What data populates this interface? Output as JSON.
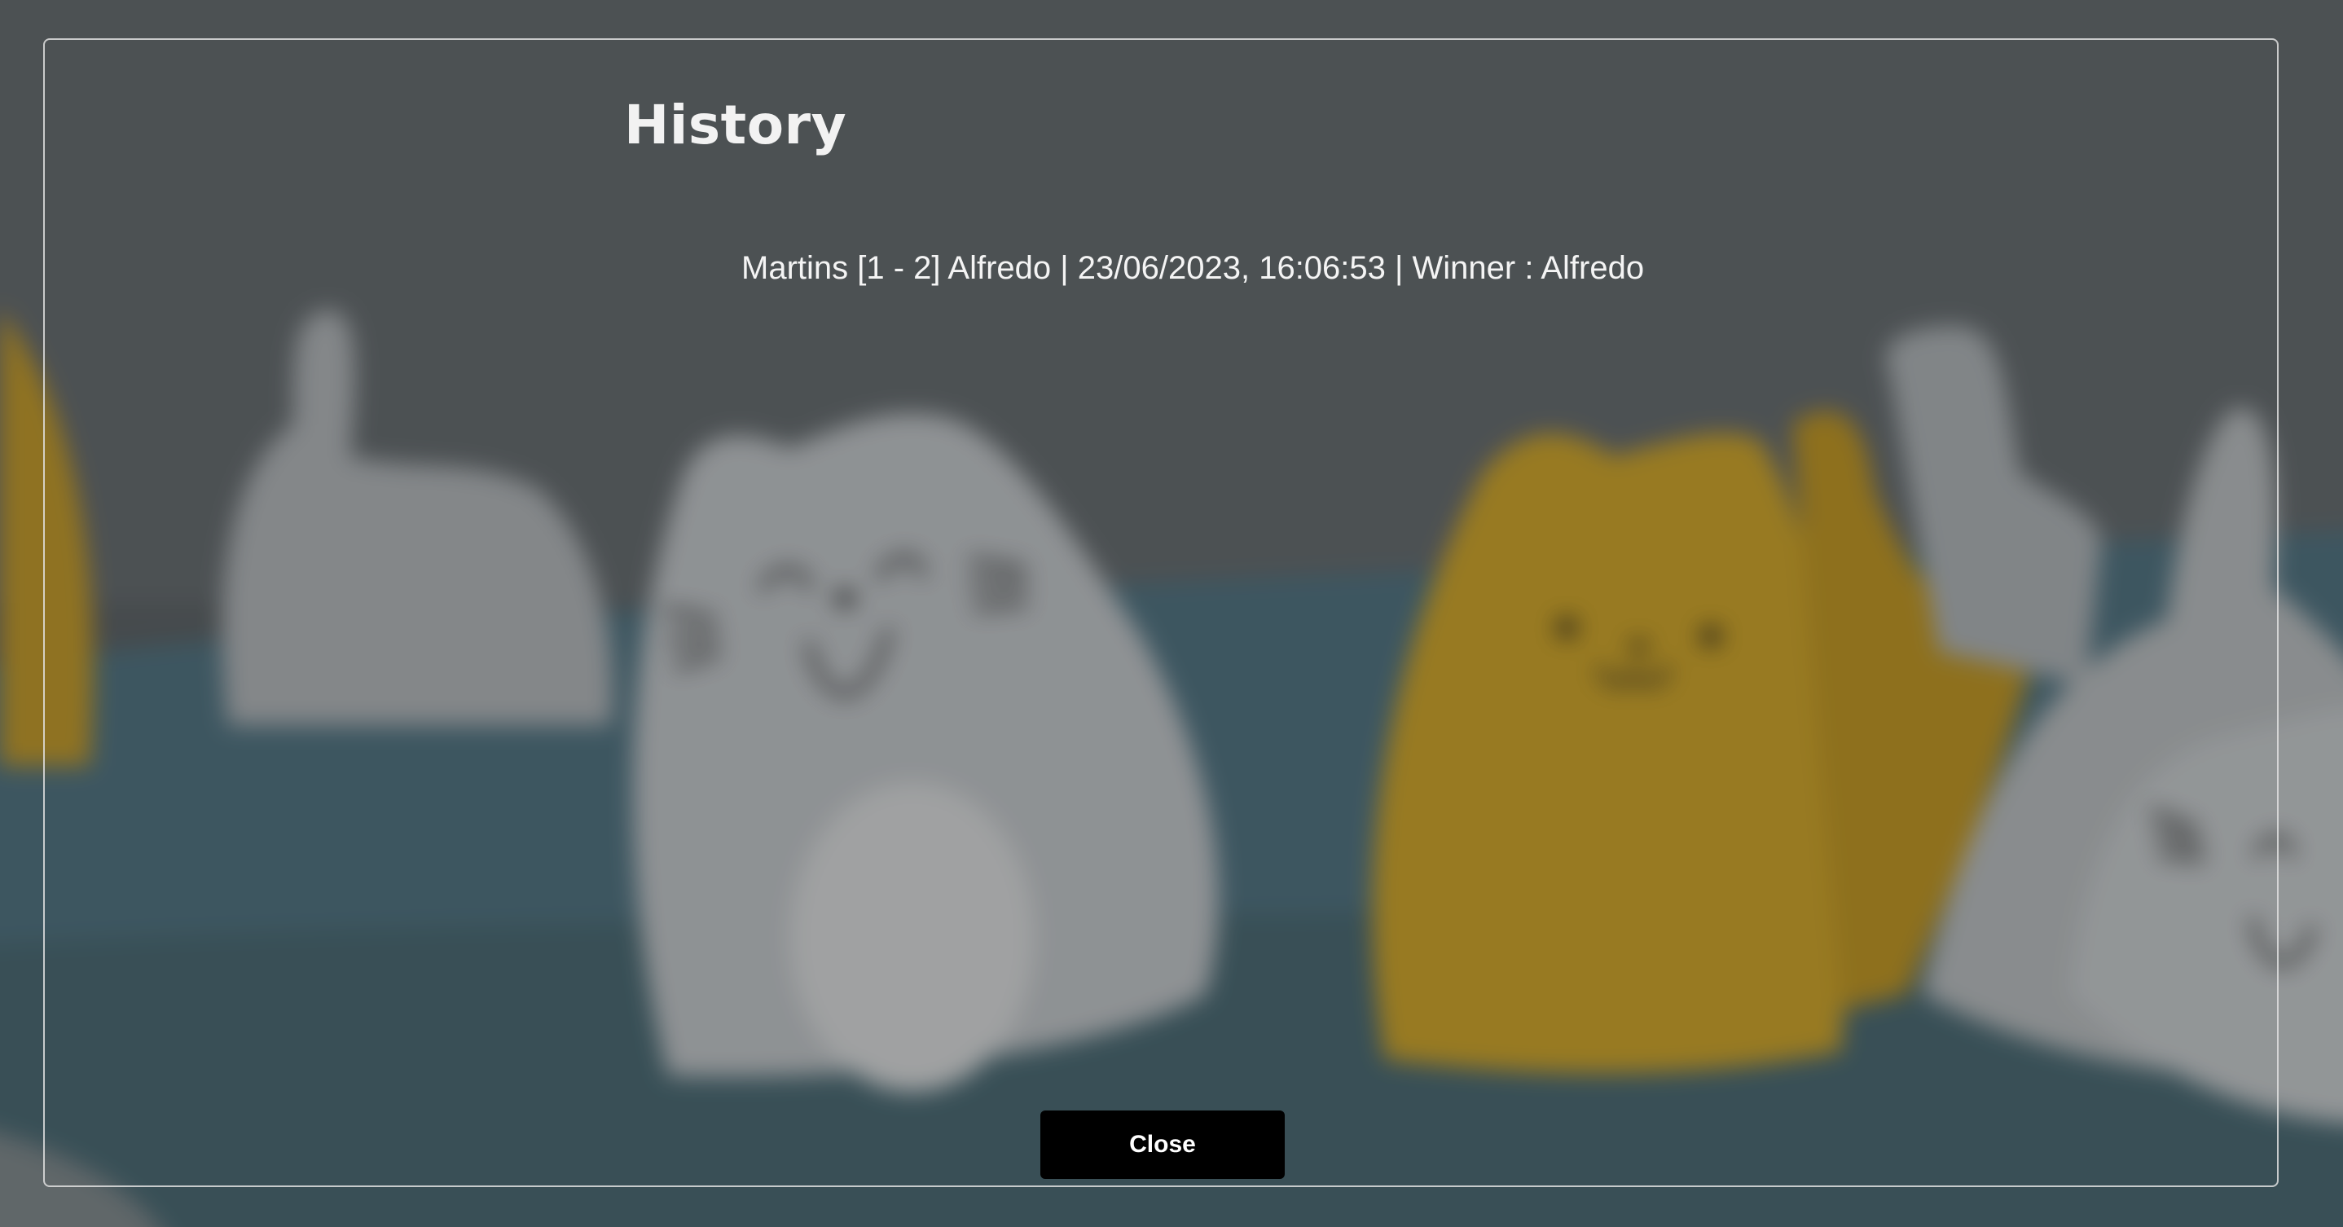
{
  "modal": {
    "title": "History",
    "entries": [
      "Martins [1 - 2] Alfredo | 23/06/2023, 16:06:53 | Winner : Alfredo"
    ],
    "close_label": "Close"
  },
  "colors": {
    "overlay_border": "#e1e1e1",
    "button_background": "#000000",
    "button_text": "#ffffff",
    "text": "#f4f4f4"
  }
}
